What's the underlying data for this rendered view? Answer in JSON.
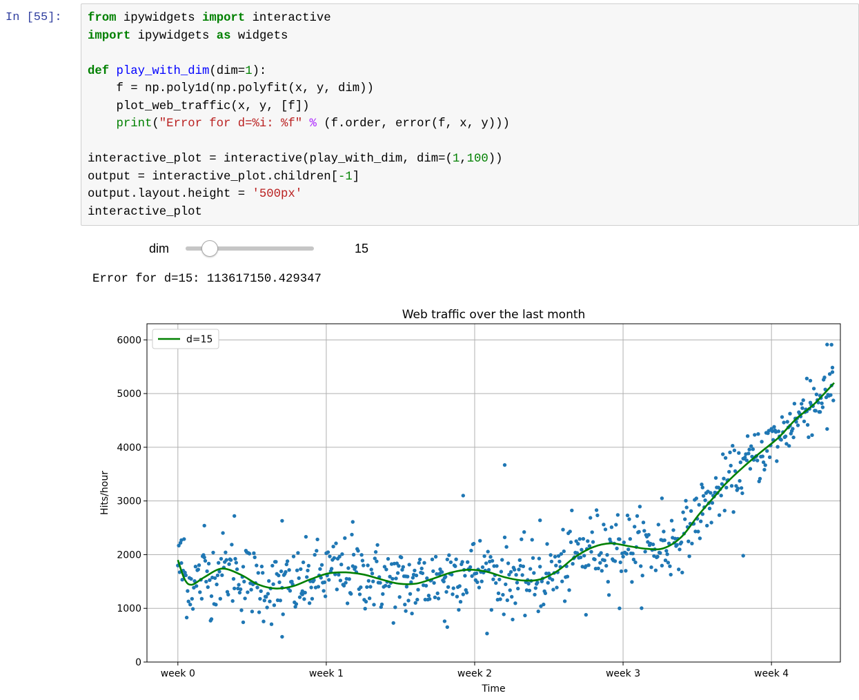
{
  "cell": {
    "prompt": "In [55]:",
    "code": {
      "kw_from": "from",
      "mod_ipywidgets": "ipywidgets",
      "kw_import": "import",
      "name_interactive": "interactive",
      "kw_import2": "import",
      "mod_ipywidgets2": "ipywidgets",
      "kw_as": "as",
      "name_widgets": "widgets",
      "kw_def": "def",
      "fn_name": "play_with_dim",
      "def_args_open": "(dim=",
      "def_num": "1",
      "def_args_close": "):",
      "line_f": "    f = np.poly1d(np.polyfit(x, y, dim))",
      "line_plot": "    plot_web_traffic(x, y, [f])",
      "print_kw": "print",
      "print_open": "(",
      "print_str": "\"Error for d=%i: %f\"",
      "print_op": "%",
      "print_rest": " (f.order, error(f, x, y)))",
      "line_ip_pre": "interactive_plot = interactive(play_with_dim, dim=(",
      "line_ip_n1": "1",
      "line_ip_comma": ",",
      "line_ip_n2": "100",
      "line_ip_post": "))",
      "line_out_pre": "output = interactive_plot.children[",
      "line_out_num": "-1",
      "line_out_post": "]",
      "line_layout_pre": "output.layout.height = ",
      "line_layout_str": "'500px'",
      "line_last": "interactive_plot"
    }
  },
  "widget": {
    "label": "dim",
    "value": "15",
    "min": 1,
    "max": 100
  },
  "output": {
    "text": "Error for d=15: 113617150.429347"
  },
  "colors": {
    "scatter": "#1f77b4",
    "fit_line": "#008000",
    "grid": "#b0b0b0"
  },
  "chart_data": {
    "type": "scatter",
    "title": "Web traffic over the last month",
    "xlabel": "Time",
    "ylabel": "Hits/hour",
    "xlim": [
      -35,
      750
    ],
    "ylim": [
      0,
      6300
    ],
    "x_ticks": [
      0,
      168,
      336,
      504,
      672
    ],
    "x_tick_labels": [
      "week 0",
      "week 1",
      "week 2",
      "week 3",
      "week 4"
    ],
    "y_ticks": [
      0,
      1000,
      2000,
      3000,
      4000,
      5000,
      6000
    ],
    "y_tick_labels": [
      "0",
      "1000",
      "2000",
      "3000",
      "4000",
      "5000",
      "6000"
    ],
    "grid": true,
    "legend": {
      "position": "top-left",
      "entries": [
        "d=15"
      ]
    },
    "fit_curve": {
      "name": "d=15",
      "x": [
        0,
        8,
        16,
        30,
        50,
        72,
        90,
        110,
        130,
        150,
        170,
        190,
        210,
        230,
        250,
        270,
        290,
        310,
        330,
        350,
        370,
        390,
        410,
        430,
        450,
        470,
        490,
        510,
        530,
        550,
        570,
        590,
        610,
        620,
        640,
        660,
        680,
        700,
        720,
        743
      ],
      "y": [
        1900,
        1530,
        1440,
        1580,
        1740,
        1620,
        1450,
        1370,
        1410,
        1540,
        1650,
        1670,
        1630,
        1540,
        1460,
        1460,
        1560,
        1670,
        1720,
        1680,
        1580,
        1520,
        1540,
        1700,
        1960,
        2140,
        2210,
        2160,
        2110,
        2120,
        2330,
        2750,
        3130,
        3320,
        3630,
        3910,
        4180,
        4530,
        4800,
        5200
      ]
    },
    "scatter_series": {
      "name": "hits",
      "count": 743,
      "highlights": [
        {
          "x": 4,
          "y": 2270
        },
        {
          "x": 7,
          "y": 2290
        },
        {
          "x": 30,
          "y": 2540
        },
        {
          "x": 38,
          "y": 800
        },
        {
          "x": 64,
          "y": 2720
        },
        {
          "x": 74,
          "y": 740
        },
        {
          "x": 118,
          "y": 2630
        },
        {
          "x": 118,
          "y": 470
        },
        {
          "x": 141,
          "y": 1320
        },
        {
          "x": 198,
          "y": 2610
        },
        {
          "x": 258,
          "y": 950
        },
        {
          "x": 302,
          "y": 760
        },
        {
          "x": 305,
          "y": 650
        },
        {
          "x": 323,
          "y": 3100
        },
        {
          "x": 370,
          "y": 3670
        },
        {
          "x": 410,
          "y": 2640
        },
        {
          "x": 462,
          "y": 880
        },
        {
          "x": 500,
          "y": 1000
        },
        {
          "x": 548,
          "y": 3050
        },
        {
          "x": 594,
          "y": 3250
        },
        {
          "x": 640,
          "y": 1980
        },
        {
          "x": 693,
          "y": 4400
        },
        {
          "x": 712,
          "y": 5280
        },
        {
          "x": 716,
          "y": 5240
        },
        {
          "x": 727,
          "y": 4960
        },
        {
          "x": 740,
          "y": 5910
        },
        {
          "x": 741,
          "y": 5400
        },
        {
          "x": 735,
          "y": 4340
        }
      ]
    }
  }
}
